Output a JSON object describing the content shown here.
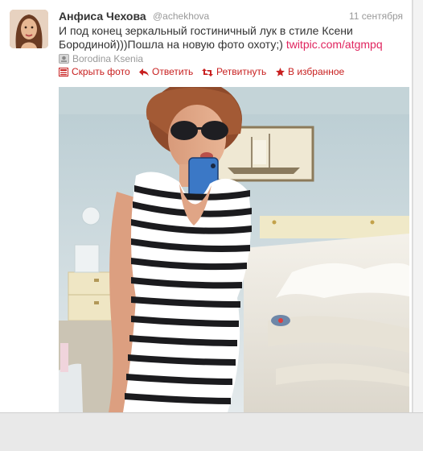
{
  "tweet": {
    "author_name": "Анфиса Чехова",
    "author_handle": "@achekhova",
    "date": "11 сентября",
    "text_line1": "И под конец зеркальный гостиничный лук в стиле Ксени",
    "text_line2": "Бородиной)))Пошла на новую фото охоту;) ",
    "link": "twitpic.com/atgmpq",
    "place": "Borodina Ksenia"
  },
  "actions": {
    "hide_photo": "Скрыть фото",
    "reply": "Ответить",
    "retweet": "Ретвитнуть",
    "favorite": "В избранное"
  },
  "icons": {
    "place": "location-icon",
    "hide_photo": "photo-icon",
    "reply": "reply-arrow-icon",
    "retweet": "retweet-icon",
    "favorite": "star-icon"
  },
  "colors": {
    "action": "#c82020",
    "link": "#e0245e",
    "meta": "#999999",
    "text": "#333333"
  }
}
